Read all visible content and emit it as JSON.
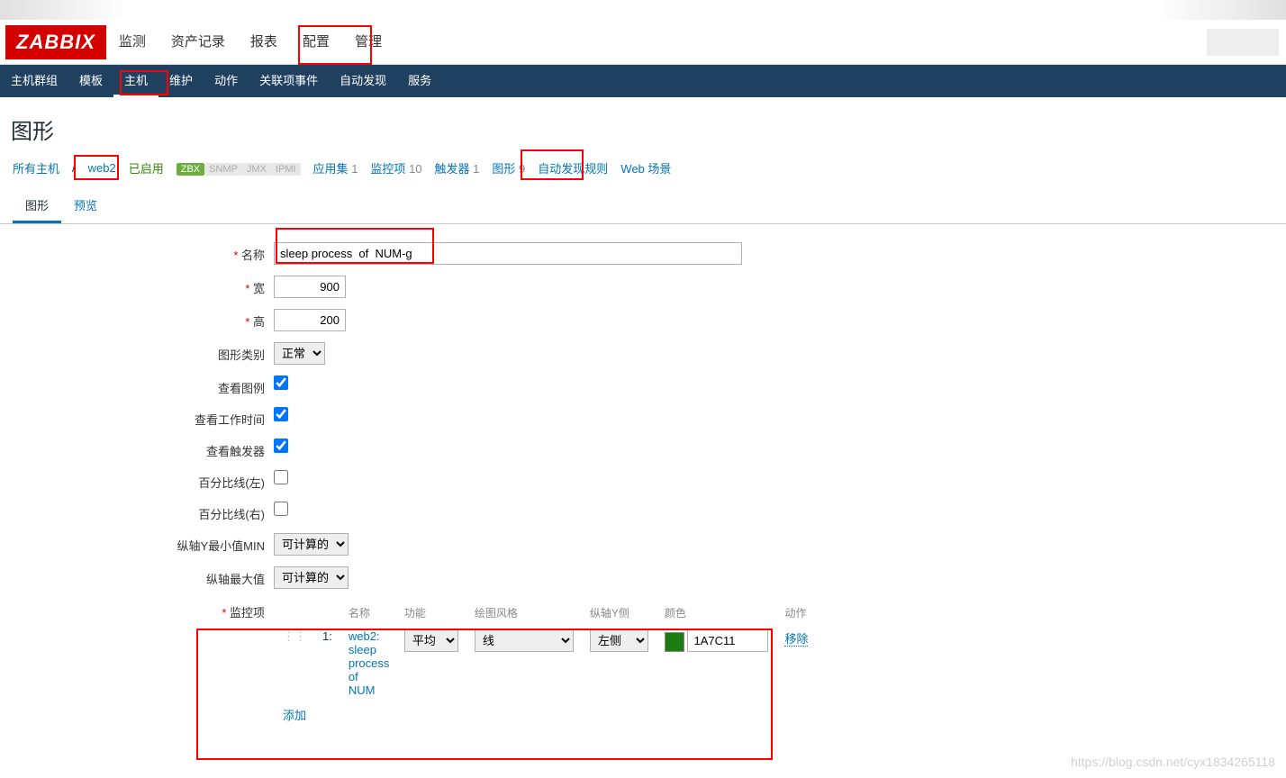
{
  "logo": "ZABBIX",
  "mainnav": [
    "监测",
    "资产记录",
    "报表",
    "配置",
    "管理"
  ],
  "subnav": [
    "主机群组",
    "模板",
    "主机",
    "维护",
    "动作",
    "关联项事件",
    "自动发现",
    "服务"
  ],
  "pageTitle": "图形",
  "hostbar": {
    "allHosts": "所有主机",
    "host": "web2",
    "enabled": "已启用",
    "badges": {
      "zbx": "ZBX",
      "snmp": "SNMP",
      "jmx": "JMX",
      "ipmi": "IPMI"
    },
    "links": {
      "apps": "应用集",
      "appsCount": "1",
      "items": "监控项",
      "itemsCount": "10",
      "triggers": "触发器",
      "triggersCount": "1",
      "graphs": "图形",
      "graphsCount": "9",
      "discovery": "自动发现规则",
      "web": "Web 场景"
    }
  },
  "tabs2": [
    "图形",
    "预览"
  ],
  "labels": {
    "name": "名称",
    "width": "宽",
    "height": "高",
    "type": "图形类别",
    "legend": "查看图例",
    "worktime": "查看工作时间",
    "triggers": "查看触发器",
    "pctLeft": "百分比线(左)",
    "pctRight": "百分比线(右)",
    "yminType": "纵轴Y最小值MIN",
    "ymaxType": "纵轴最大值",
    "items": "监控项"
  },
  "values": {
    "name": "sleep process  of  NUM-g",
    "width": "900",
    "height": "200",
    "type": "正常",
    "yminType": "可计算的",
    "ymaxType": "可计算的"
  },
  "itemsTable": {
    "headers": {
      "name": "名称",
      "func": "功能",
      "style": "绘图风格",
      "yaxis": "纵轴Y侧",
      "color": "颜色",
      "action": "动作"
    },
    "row": {
      "idx": "1:",
      "name": "web2: sleep process of NUM",
      "func": "平均",
      "style": "线",
      "yaxis": "左侧",
      "colorHex": "1A7C11",
      "remove": "移除"
    },
    "add": "添加"
  },
  "watermark": "https://blog.csdn.net/cyx1834265118"
}
